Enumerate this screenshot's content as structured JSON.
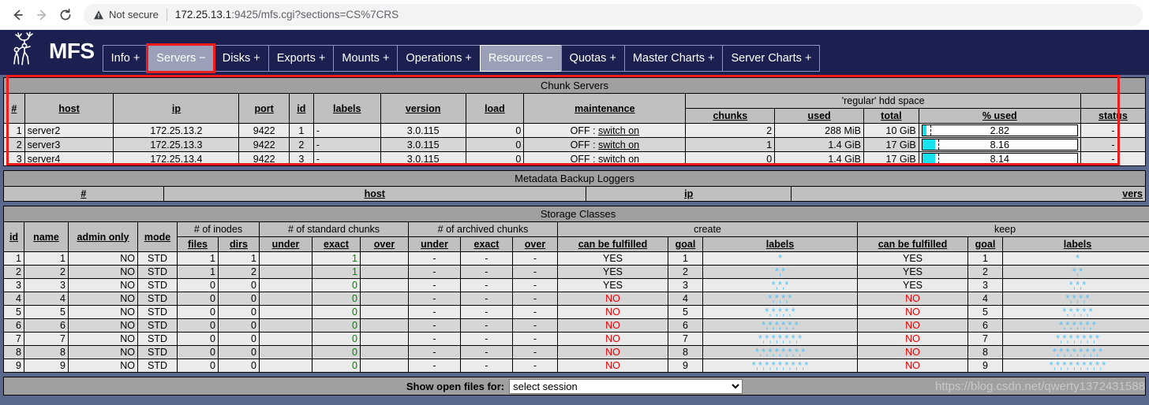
{
  "browser": {
    "back_icon": "arrow-left-icon",
    "forward_icon": "arrow-right-icon",
    "reload_icon": "reload-icon",
    "warning_icon": "warning-triangle-icon",
    "security_label": "Not secure",
    "url_host": "172.25.13.1",
    "url_rest": ":9425/mfs.cgi?sections=CS%7CRS"
  },
  "app": {
    "logo_text": "MFS",
    "logo_icon": "moose-logo-icon",
    "nav": [
      {
        "label": "Info +",
        "state": "normal"
      },
      {
        "label": "Servers −",
        "state": "highlight"
      },
      {
        "label": "Disks +",
        "state": "normal"
      },
      {
        "label": "Exports +",
        "state": "normal"
      },
      {
        "label": "Mounts +",
        "state": "normal"
      },
      {
        "label": "Operations +",
        "state": "normal"
      },
      {
        "label": "Resources −",
        "state": "active"
      },
      {
        "label": "Quotas +",
        "state": "normal"
      },
      {
        "label": "Master Charts +",
        "state": "normal"
      },
      {
        "label": "Server Charts +",
        "state": "normal"
      }
    ]
  },
  "chunk_servers": {
    "title": "Chunk Servers",
    "group_hdd": "'regular' hdd space",
    "columns": {
      "num": "#",
      "host": "host",
      "ip": "ip",
      "port": "port",
      "id": "id",
      "labels": "labels",
      "version": "version",
      "load": "load",
      "maintenance": "maintenance",
      "chunks": "chunks",
      "used": "used",
      "total": "total",
      "pct_used": "% used",
      "status": "status"
    },
    "rows": [
      {
        "num": "1",
        "host": "server2",
        "ip": "172.25.13.2",
        "port": "9422",
        "id": "1",
        "labels": "-",
        "version": "3.0.115",
        "load": "0",
        "maint_state": "OFF : ",
        "maint_link": "switch on",
        "chunks": "2",
        "used": "288 MiB",
        "total": "10 GiB",
        "pct": "2.82",
        "pct_value": 2.82,
        "status": "-"
      },
      {
        "num": "2",
        "host": "server3",
        "ip": "172.25.13.3",
        "port": "9422",
        "id": "2",
        "labels": "-",
        "version": "3.0.115",
        "load": "0",
        "maint_state": "OFF : ",
        "maint_link": "switch on",
        "chunks": "1",
        "used": "1.4 GiB",
        "total": "17 GiB",
        "pct": "8.16",
        "pct_value": 8.16,
        "status": "-"
      },
      {
        "num": "3",
        "host": "server4",
        "ip": "172.25.13.4",
        "port": "9422",
        "id": "3",
        "labels": "-",
        "version": "3.0.115",
        "load": "0",
        "maint_state": "OFF : ",
        "maint_link": "switch on",
        "chunks": "0",
        "used": "1.4 GiB",
        "total": "17 GiB",
        "pct": "8.14",
        "pct_value": 8.14,
        "status": "-"
      }
    ]
  },
  "metadata_backup_loggers": {
    "title": "Metadata Backup Loggers",
    "columns": {
      "num": "#",
      "host": "host",
      "ip": "ip",
      "version": "vers"
    },
    "rows": []
  },
  "storage_classes": {
    "title": "Storage Classes",
    "groups": {
      "inodes": "# of inodes",
      "standard_chunks": "# of standard chunks",
      "archived_chunks": "# of archived chunks",
      "create": "create",
      "keep": "keep"
    },
    "columns": {
      "id": "id",
      "name": "name",
      "admin_only": "admin only",
      "mode": "mode",
      "files": "files",
      "dirs": "dirs",
      "std_under": "under",
      "std_exact": "exact",
      "std_over": "over",
      "arc_under": "under",
      "arc_exact": "exact",
      "arc_over": "over",
      "create_fulfilled": "can be fulfilled",
      "create_goal": "goal",
      "create_labels": "labels",
      "keep_fulfilled": "can be fulfilled",
      "keep_goal": "goal",
      "keep_labels": "labels"
    },
    "rows": [
      {
        "id": "1",
        "name": "1",
        "admin_only": "NO",
        "mode": "STD",
        "files": "1",
        "dirs": "1",
        "std_under": "",
        "std_exact": "1",
        "std_over": "",
        "arc_under": "-",
        "arc_exact": "-",
        "arc_over": "-",
        "create_fulfilled": "YES",
        "create_goal": "1",
        "create_labels": "*",
        "keep_fulfilled": "YES",
        "keep_goal": "1",
        "keep_labels": "*"
      },
      {
        "id": "2",
        "name": "2",
        "admin_only": "NO",
        "mode": "STD",
        "files": "1",
        "dirs": "2",
        "std_under": "",
        "std_exact": "1",
        "std_over": "",
        "arc_under": "-",
        "arc_exact": "-",
        "arc_over": "-",
        "create_fulfilled": "YES",
        "create_goal": "2",
        "create_labels": "*,*",
        "keep_fulfilled": "YES",
        "keep_goal": "2",
        "keep_labels": "*,*"
      },
      {
        "id": "3",
        "name": "3",
        "admin_only": "NO",
        "mode": "STD",
        "files": "0",
        "dirs": "0",
        "std_under": "",
        "std_exact": "0",
        "std_over": "",
        "arc_under": "-",
        "arc_exact": "-",
        "arc_over": "-",
        "create_fulfilled": "YES",
        "create_goal": "3",
        "create_labels": "*,*,*",
        "keep_fulfilled": "YES",
        "keep_goal": "3",
        "keep_labels": "*,*,*"
      },
      {
        "id": "4",
        "name": "4",
        "admin_only": "NO",
        "mode": "STD",
        "files": "0",
        "dirs": "0",
        "std_under": "",
        "std_exact": "0",
        "std_over": "",
        "arc_under": "-",
        "arc_exact": "-",
        "arc_over": "-",
        "create_fulfilled": "NO",
        "create_goal": "4",
        "create_labels": "*,*,*,*",
        "keep_fulfilled": "NO",
        "keep_goal": "4",
        "keep_labels": "*,*,*,*"
      },
      {
        "id": "5",
        "name": "5",
        "admin_only": "NO",
        "mode": "STD",
        "files": "0",
        "dirs": "0",
        "std_under": "",
        "std_exact": "0",
        "std_over": "",
        "arc_under": "-",
        "arc_exact": "-",
        "arc_over": "-",
        "create_fulfilled": "NO",
        "create_goal": "5",
        "create_labels": "*,*,*,*,*",
        "keep_fulfilled": "NO",
        "keep_goal": "5",
        "keep_labels": "*,*,*,*,*"
      },
      {
        "id": "6",
        "name": "6",
        "admin_only": "NO",
        "mode": "STD",
        "files": "0",
        "dirs": "0",
        "std_under": "",
        "std_exact": "0",
        "std_over": "",
        "arc_under": "-",
        "arc_exact": "-",
        "arc_over": "-",
        "create_fulfilled": "NO",
        "create_goal": "6",
        "create_labels": "*,*,*,*,*,*",
        "keep_fulfilled": "NO",
        "keep_goal": "6",
        "keep_labels": "*,*,*,*,*,*"
      },
      {
        "id": "7",
        "name": "7",
        "admin_only": "NO",
        "mode": "STD",
        "files": "0",
        "dirs": "0",
        "std_under": "",
        "std_exact": "0",
        "std_over": "",
        "arc_under": "-",
        "arc_exact": "-",
        "arc_over": "-",
        "create_fulfilled": "NO",
        "create_goal": "7",
        "create_labels": "*,*,*,*,*,*,*",
        "keep_fulfilled": "NO",
        "keep_goal": "7",
        "keep_labels": "*,*,*,*,*,*,*"
      },
      {
        "id": "8",
        "name": "8",
        "admin_only": "NO",
        "mode": "STD",
        "files": "0",
        "dirs": "0",
        "std_under": "",
        "std_exact": "0",
        "std_over": "",
        "arc_under": "-",
        "arc_exact": "-",
        "arc_over": "-",
        "create_fulfilled": "NO",
        "create_goal": "8",
        "create_labels": "*,*,*,*,*,*,*,*",
        "keep_fulfilled": "NO",
        "keep_goal": "8",
        "keep_labels": "*,*,*,*,*,*,*,*"
      },
      {
        "id": "9",
        "name": "9",
        "admin_only": "NO",
        "mode": "STD",
        "files": "0",
        "dirs": "0",
        "std_under": "",
        "std_exact": "0",
        "std_over": "",
        "arc_under": "-",
        "arc_exact": "-",
        "arc_over": "-",
        "create_fulfilled": "NO",
        "create_goal": "9",
        "create_labels": "*,*,*,*,*,*,*,*,*",
        "keep_fulfilled": "NO",
        "keep_goal": "9",
        "keep_labels": "*,*,*,*,*,*,*,*,*"
      }
    ]
  },
  "footer": {
    "label": "Show open files for:",
    "select_value": "select session",
    "options": [
      "select session"
    ]
  },
  "watermark": "https://blog.csdn.net/qwerty1372431588",
  "colors": {
    "header_bg": "#1b2050",
    "page_bg": "#5a678f",
    "table_title_bg": "#a0a0a0",
    "table_header_bg": "#c0c0c0",
    "row_odd": "#ebebeb",
    "row_even": "#d6d6d6",
    "accent_red": "#ee1c1c",
    "bar_fill": "#18e2ee",
    "label_star": "#4fc3f7",
    "ok_green": "#008000",
    "fail_red": "#ee0000"
  }
}
